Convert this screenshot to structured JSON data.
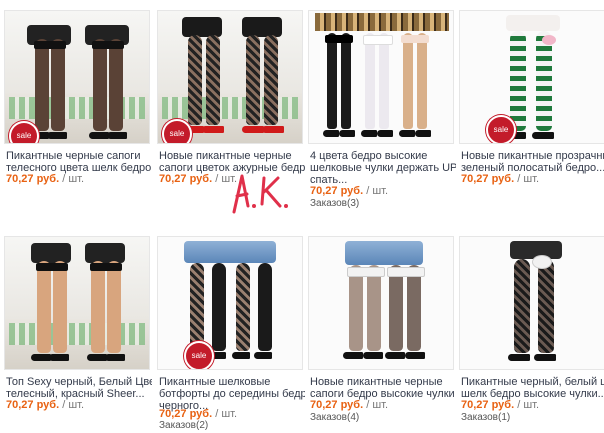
{
  "sale_badge": "sale",
  "price_unit": "/ шт.",
  "handwriting": "А.К.",
  "products": [
    {
      "title_lines": [
        "Пикантные черные сапоги",
        "телесного цвета шелк бедро..."
      ],
      "price": "70,27 руб.",
      "orders": null
    },
    {
      "title_lines": [
        "Новые пикантные черные",
        "сапоги цветок ажурные бедро..."
      ],
      "price": "70,27 руб.",
      "orders": null
    },
    {
      "title_lines": [
        "4 цвета бедро высокие",
        "шелковые чулки держать UPS",
        "спать..."
      ],
      "price": "70,27 руб.",
      "orders": "Заказов(3)"
    },
    {
      "title_lines": [
        "Новые пикантные прозрачные",
        "зеленый полосатый бедро..."
      ],
      "price": "70,27 руб.",
      "orders": null
    },
    {
      "title_lines": [
        "Топ Sexy черный, Белый Цвет",
        "телесный, красный Sheer..."
      ],
      "price": "70,27 руб.",
      "orders": null
    },
    {
      "title_lines": [
        "Пикантные шелковые",
        "ботфорты до середины бедра",
        "черного..."
      ],
      "price": "70,27 руб.",
      "orders": "Заказов(2)"
    },
    {
      "title_lines": [
        "Новые пикантные черные",
        "сапоги бедро высокие чулки в..."
      ],
      "price": "70,27 руб.",
      "orders": "Заказов(4)"
    },
    {
      "title_lines": [
        "Пикантные черный, белый цвет",
        "шелк бедро высокие чулки..."
      ],
      "price": "70,27 руб.",
      "orders": "Заказов(1)"
    }
  ],
  "colors": {
    "price": "#e86213",
    "sale_badge": "#c31b2a",
    "handwriting": "#e0304a"
  }
}
